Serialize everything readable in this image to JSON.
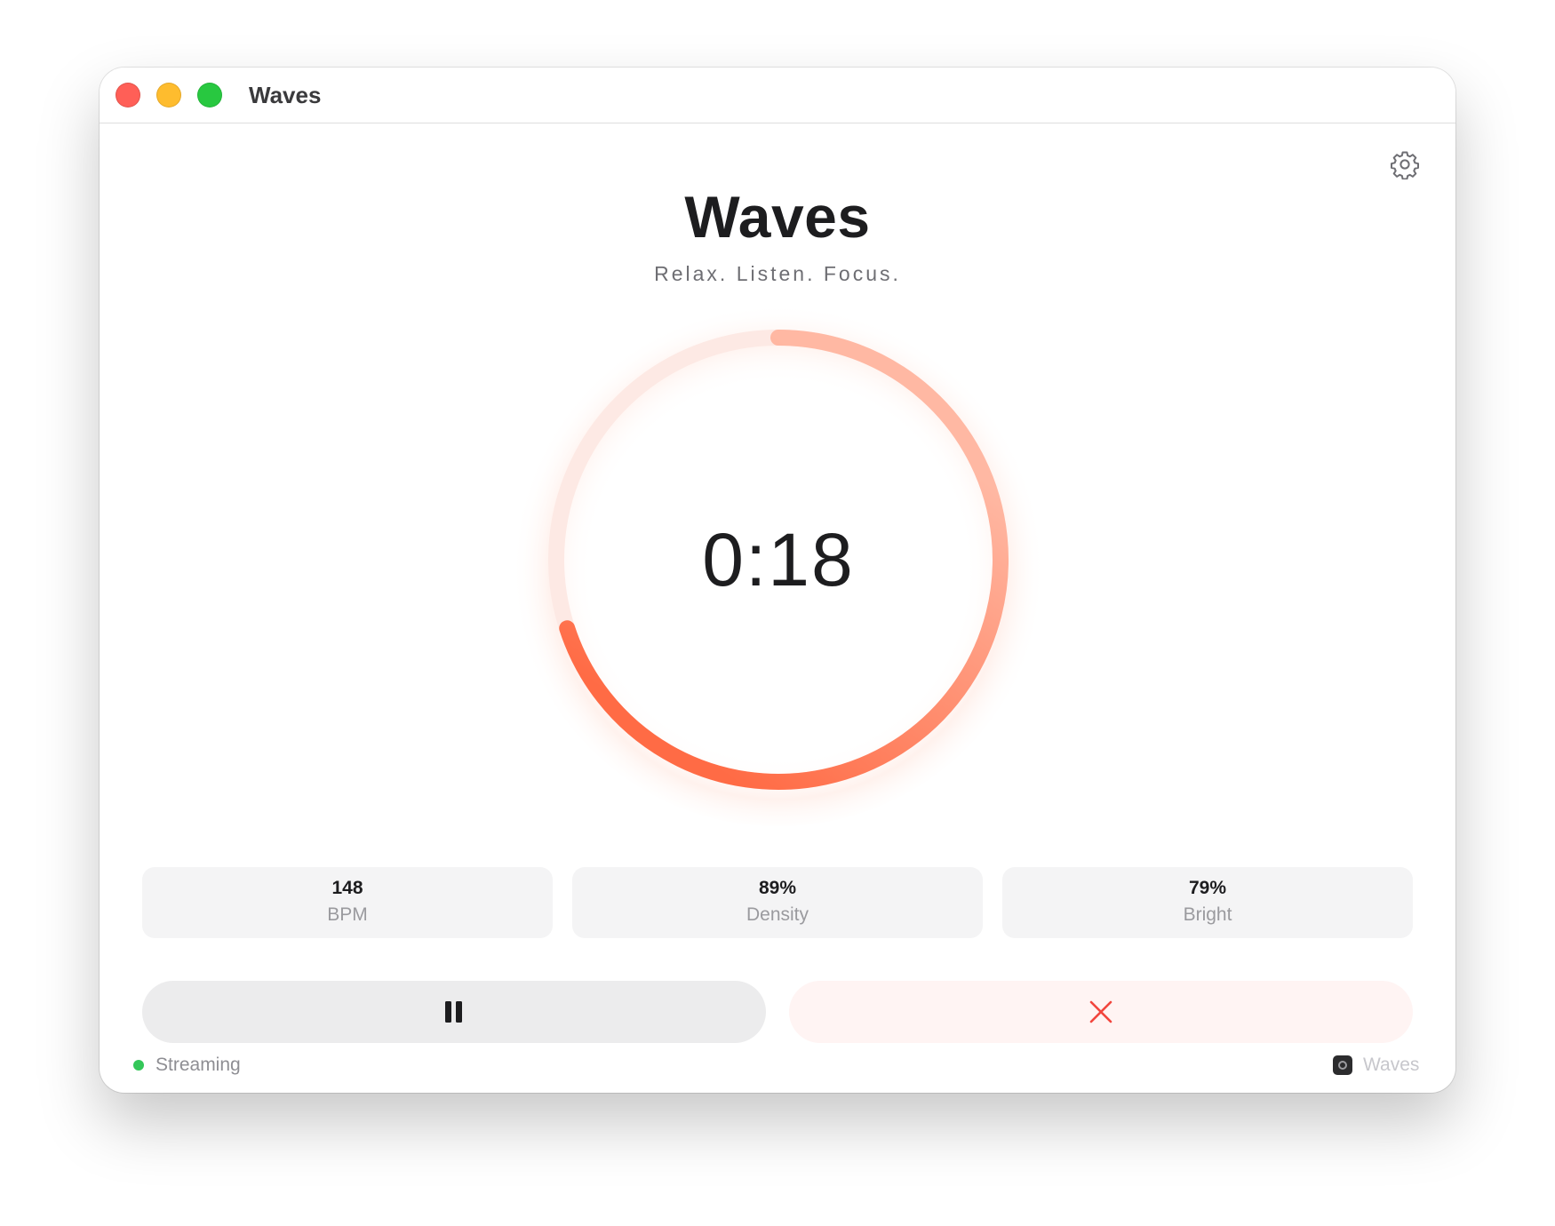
{
  "window": {
    "title": "Waves"
  },
  "header": {
    "title": "Waves",
    "tagline": "Relax. Listen. Focus."
  },
  "timer": {
    "display": "0:18",
    "progress_fraction": 0.7
  },
  "stats": [
    {
      "value": "148",
      "label": "BPM"
    },
    {
      "value": "89%",
      "label": "Density"
    },
    {
      "value": "79%",
      "label": "Bright"
    }
  ],
  "controls": {
    "pause_icon": "pause-icon",
    "stop_icon": "close-icon"
  },
  "status": {
    "text": "Streaming",
    "color": "#34c759"
  },
  "footer": {
    "brand": "Waves"
  },
  "colors": {
    "accent": "#ff6b45",
    "accent_light": "#ffb8a3",
    "track": "#fde9e4",
    "stop_icon": "#f2453d"
  }
}
